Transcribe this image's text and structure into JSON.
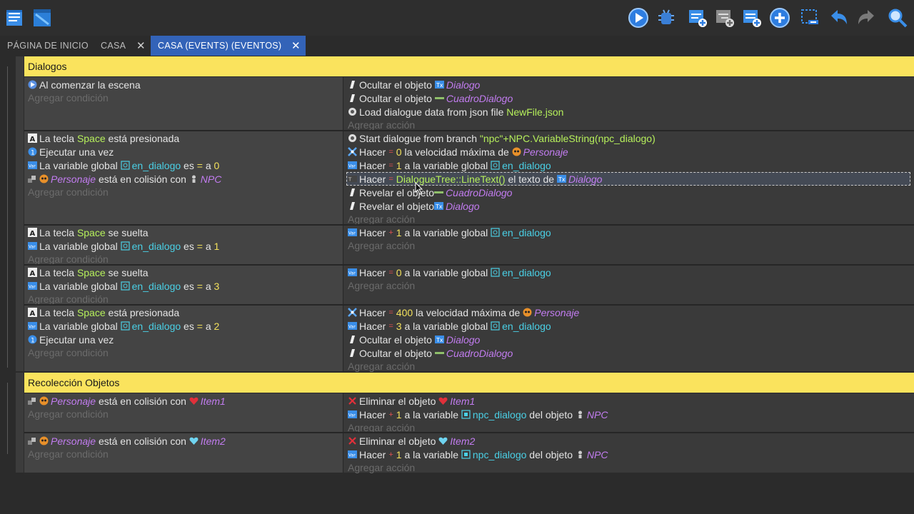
{
  "colors": {
    "group_bar": "#fae35d",
    "tab_active": "#3363b8",
    "key_green": "#b6f05b",
    "number_yellow": "#f2e05c",
    "variable_cyan": "#4ad0e6",
    "object_purple": "#c27cf0"
  },
  "toolbar": {
    "left_icons": [
      "project-manager-icon",
      "scene-editor-icon"
    ],
    "right_icons": [
      "preview-play-icon",
      "debugger-icon",
      "add-event-icon",
      "add-subevent-icon",
      "add-comment-icon",
      "add-more-icon",
      "delete-event-icon",
      "undo-icon",
      "redo-icon",
      "search-icon"
    ]
  },
  "tabs": [
    {
      "label": "PÁGINA DE INICIO"
    },
    {
      "label": "CASA",
      "close": "✕"
    },
    {
      "label": "CASA (EVENTS) (EVENTOS)",
      "close": "✕"
    }
  ],
  "placeholders": {
    "add_condition": "Agregar condición",
    "add_action": "Agregar acción"
  },
  "groups": {
    "dialogos": "Dialogos",
    "recoleccion": "Recolección Objetos"
  },
  "events": {
    "e1": {
      "c1": "Al comenzar la escena",
      "a1": {
        "text": "Ocultar el objeto",
        "obj": "Dialogo"
      },
      "a2": {
        "text": "Ocultar el objeto",
        "obj": "CuadroDialogo"
      },
      "a3": {
        "text": "Load dialogue data from json file",
        "file": "NewFile.json"
      }
    },
    "e2": {
      "c1": {
        "pre": "La tecla",
        "key": "Space",
        "post": "está presionada"
      },
      "c2": "Ejecutar una vez",
      "c3": {
        "pre": "La variable global",
        "var": "en_dialogo",
        "mid": "es",
        "op": "=",
        "post": "a",
        "val": "0"
      },
      "c4": {
        "obj": "Personaje",
        "mid": "está en colisión con",
        "obj2": "NPC"
      },
      "a1": {
        "pre": "Start dialogue from branch",
        "expr": "\"npc\"+NPC.VariableString(npc_dialogo)"
      },
      "a2": {
        "pre": "Hacer",
        "op": "=",
        "val": "0",
        "mid": "la velocidad máxima de",
        "obj": "Personaje"
      },
      "a3": {
        "pre": "Hacer",
        "op": "=",
        "val": "1",
        "mid": "a la variable global",
        "var": "en_dialogo"
      },
      "a4": {
        "pre": "Hacer",
        "op": "=",
        "expr": "DialogueTree::LineText()",
        "mid": "el texto de",
        "obj": "Dialogo"
      },
      "a5": {
        "text": "Revelar el objeto",
        "obj": "CuadroDialogo"
      },
      "a6": {
        "text": "Revelar el objeto",
        "obj": "Dialogo"
      }
    },
    "e3": {
      "c1": {
        "pre": "La tecla",
        "key": "Space",
        "post": "se suelta"
      },
      "c2": {
        "pre": "La variable global",
        "var": "en_dialogo",
        "mid": "es",
        "op": "=",
        "post": "a",
        "val": "1"
      },
      "a1": {
        "pre": "Hacer",
        "op": "+",
        "val": "1",
        "mid": "a la variable global",
        "var": "en_dialogo"
      }
    },
    "e4": {
      "c1": {
        "pre": "La tecla",
        "key": "Space",
        "post": "se suelta"
      },
      "c2": {
        "pre": "La variable global",
        "var": "en_dialogo",
        "mid": "es",
        "op": "=",
        "post": "a",
        "val": "3"
      },
      "a1": {
        "pre": "Hacer",
        "op": "=",
        "val": "0",
        "mid": "a la variable global",
        "var": "en_dialogo"
      }
    },
    "e5": {
      "c1": {
        "pre": "La tecla",
        "key": "Space",
        "post": "está presionada"
      },
      "c2": {
        "pre": "La variable global",
        "var": "en_dialogo",
        "mid": "es",
        "op": "=",
        "post": "a",
        "val": "2"
      },
      "c3": "Ejecutar una vez",
      "a1": {
        "pre": "Hacer",
        "op": "=",
        "val": "400",
        "mid": "la velocidad máxima de",
        "obj": "Personaje"
      },
      "a2": {
        "pre": "Hacer",
        "op": "=",
        "val": "3",
        "mid": "a la variable global",
        "var": "en_dialogo"
      },
      "a3": {
        "text": "Ocultar el objeto",
        "obj": "Dialogo"
      },
      "a4": {
        "text": "Ocultar el objeto",
        "obj": "CuadroDialogo"
      }
    },
    "e6": {
      "c1": {
        "obj": "Personaje",
        "mid": "está en colisión con",
        "obj2": "Item1"
      },
      "a1": {
        "text": "Eliminar el objeto",
        "obj": "Item1"
      },
      "a2": {
        "pre": "Hacer",
        "op": "+",
        "val": "1",
        "mid": "a la variable",
        "var": "npc_dialogo",
        "post": "del objeto",
        "obj": "NPC"
      }
    },
    "e7": {
      "c1": {
        "obj": "Personaje",
        "mid": "está en colisión con",
        "obj2": "Item2"
      },
      "a1": {
        "text": "Eliminar el objeto",
        "obj": "Item2"
      },
      "a2": {
        "pre": "Hacer",
        "op": "+",
        "val": "1",
        "mid": "a la variable",
        "var": "npc_dialogo",
        "post": "del objeto",
        "obj": "NPC"
      }
    }
  }
}
